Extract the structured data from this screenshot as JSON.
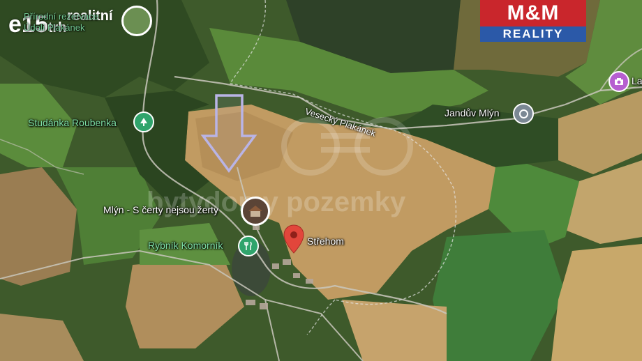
{
  "map": {
    "places": [
      {
        "label": "Přírodní rezervace Údolí Plakánek",
        "kind": "nature"
      },
      {
        "label": "Studánka Roubenka",
        "kind": "spring"
      },
      {
        "label": "Jandův Mlýn",
        "kind": "place"
      },
      {
        "label": "Mlýn - S čerty nejsou žerty",
        "kind": "attraction"
      },
      {
        "label": "Rybník Komorník",
        "kind": "pond"
      },
      {
        "label": "Střehom",
        "kind": "selected-pin"
      },
      {
        "label": "La",
        "kind": "photo-spot"
      }
    ],
    "road_label": "Vesecký Plakánek",
    "colors": {
      "pin_red": "#e2463b",
      "poi_green": "#30a46c",
      "poi_grey": "#7b8894",
      "photo_purple": "#b65fd0",
      "arrow_outline": "#b9b4e6"
    }
  },
  "watermarks": {
    "top_left_brand": "e15",
    "top_left_brand_sub": "trh",
    "top_left_realitni": "realitní",
    "top_right_brand_top": "M&M",
    "top_right_brand_bottom": "REALITY",
    "center_text": "bytydomy pozemky"
  },
  "indicator": {
    "icon": "arrow-down-icon"
  }
}
